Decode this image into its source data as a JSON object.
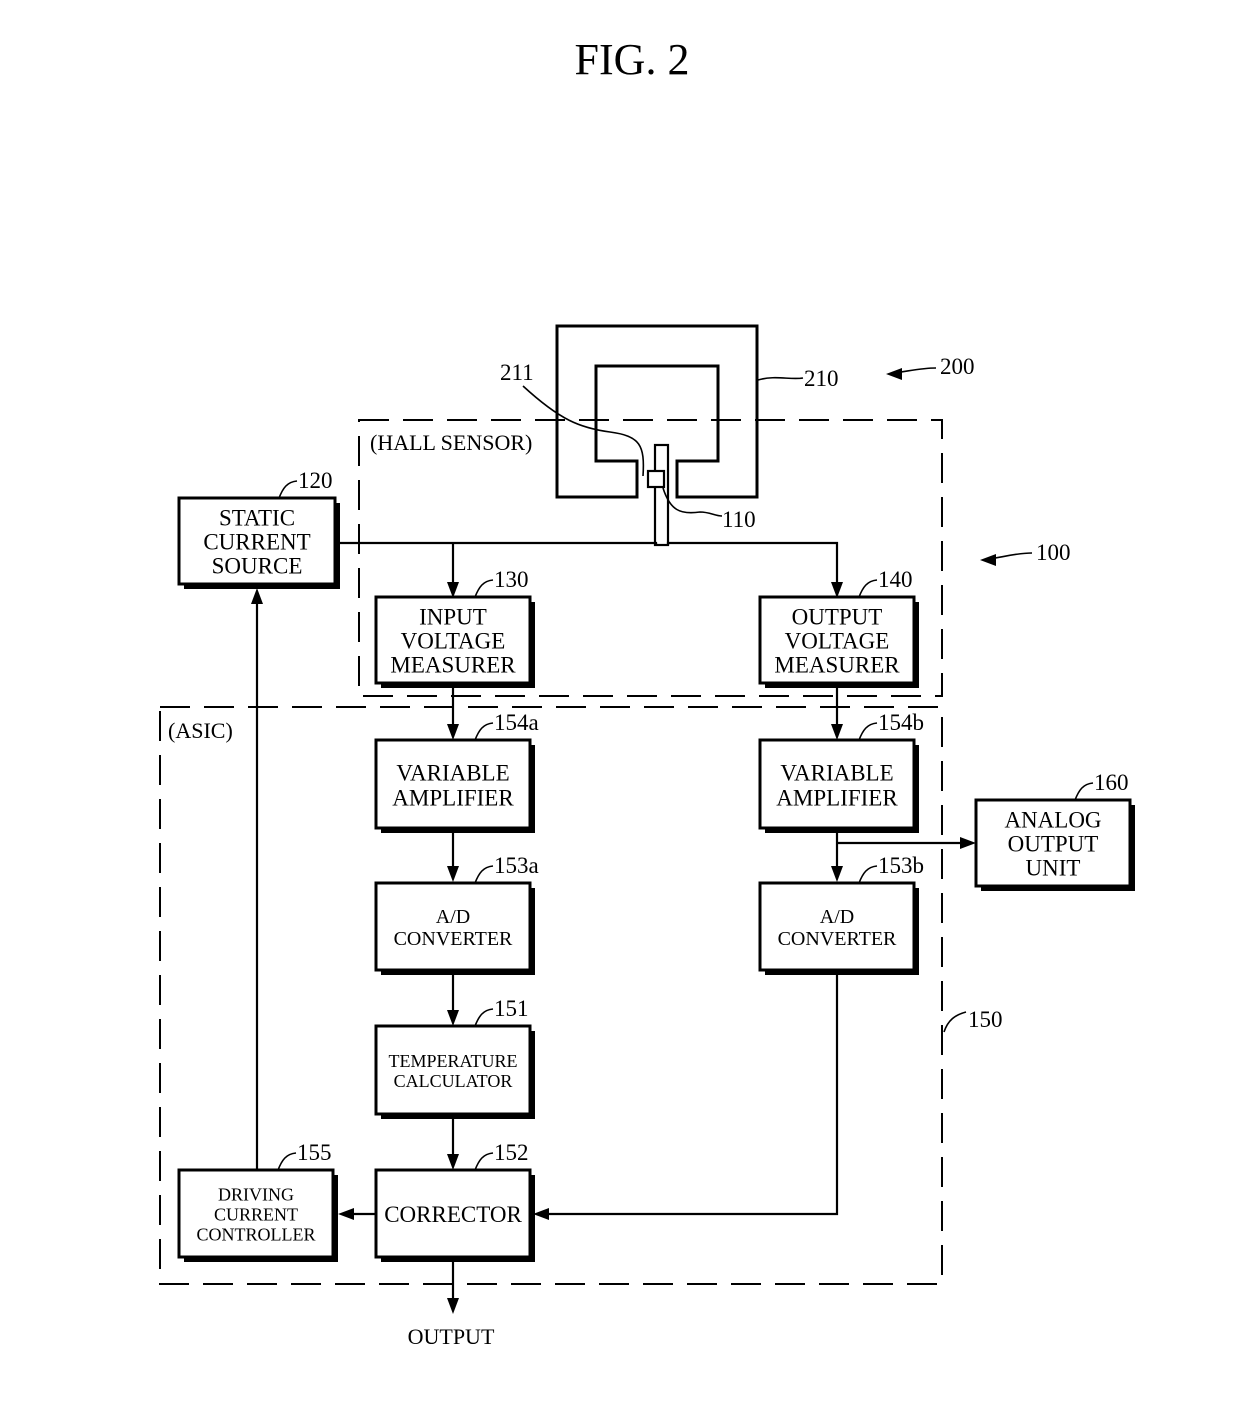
{
  "figure": {
    "title": "FIG. 2"
  },
  "regions": {
    "hall_sensor": {
      "label": "(HALL SENSOR)"
    },
    "asic": {
      "label": "(ASIC)"
    }
  },
  "references": {
    "r200": "200",
    "r210": "210",
    "r211": "211",
    "r110": "110",
    "r100": "100",
    "r150": "150"
  },
  "blocks": {
    "static_current_source": {
      "ref": "120",
      "lines": [
        "STATIC",
        "CURRENT",
        "SOURCE"
      ]
    },
    "input_voltage_measurer": {
      "ref": "130",
      "lines": [
        "INPUT",
        "VOLTAGE",
        "MEASURER"
      ]
    },
    "output_voltage_measurer": {
      "ref": "140",
      "lines": [
        "OUTPUT",
        "VOLTAGE",
        "MEASURER"
      ]
    },
    "variable_amplifier_a": {
      "ref": "154a",
      "lines": [
        "VARIABLE",
        "AMPLIFIER"
      ]
    },
    "variable_amplifier_b": {
      "ref": "154b",
      "lines": [
        "VARIABLE",
        "AMPLIFIER"
      ]
    },
    "ad_converter_a": {
      "ref": "153a",
      "lines": [
        "A/D",
        "CONVERTER"
      ]
    },
    "ad_converter_b": {
      "ref": "153b",
      "lines": [
        "A/D",
        "CONVERTER"
      ]
    },
    "analog_output_unit": {
      "ref": "160",
      "lines": [
        "ANALOG",
        "OUTPUT",
        "UNIT"
      ]
    },
    "temperature_calculator": {
      "ref": "151",
      "lines": [
        "TEMPERATURE",
        "CALCULATOR"
      ]
    },
    "corrector": {
      "ref": "152",
      "lines": [
        "CORRECTOR"
      ]
    },
    "driving_current_controller": {
      "ref": "155",
      "lines": [
        "DRIVING",
        "CURRENT",
        "CONTROLLER"
      ]
    }
  },
  "output": {
    "label": "OUTPUT"
  }
}
